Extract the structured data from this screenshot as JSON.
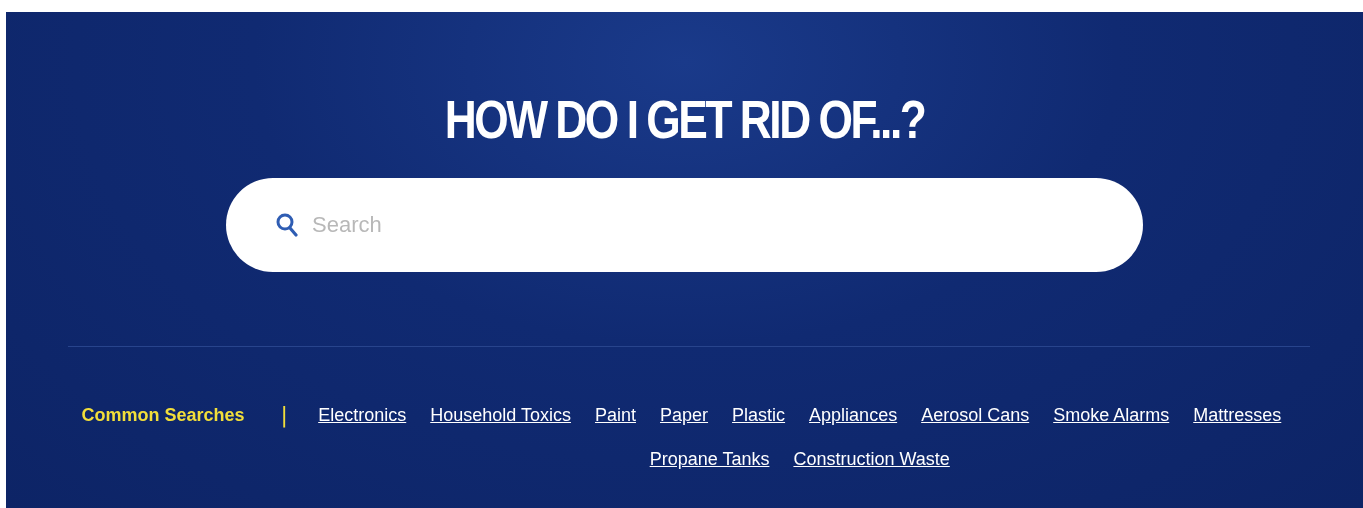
{
  "heading": "HOW DO I GET RID OF...?",
  "search": {
    "placeholder": "Search"
  },
  "common_searches": {
    "label": "Common Searches",
    "separator": "|",
    "links": [
      "Electronics",
      "Household Toxics",
      "Paint",
      "Paper",
      "Plastic",
      "Appliances",
      "Aerosol Cans",
      "Smoke Alarms",
      "Mattresses",
      "Propane Tanks",
      "Construction Waste"
    ]
  }
}
